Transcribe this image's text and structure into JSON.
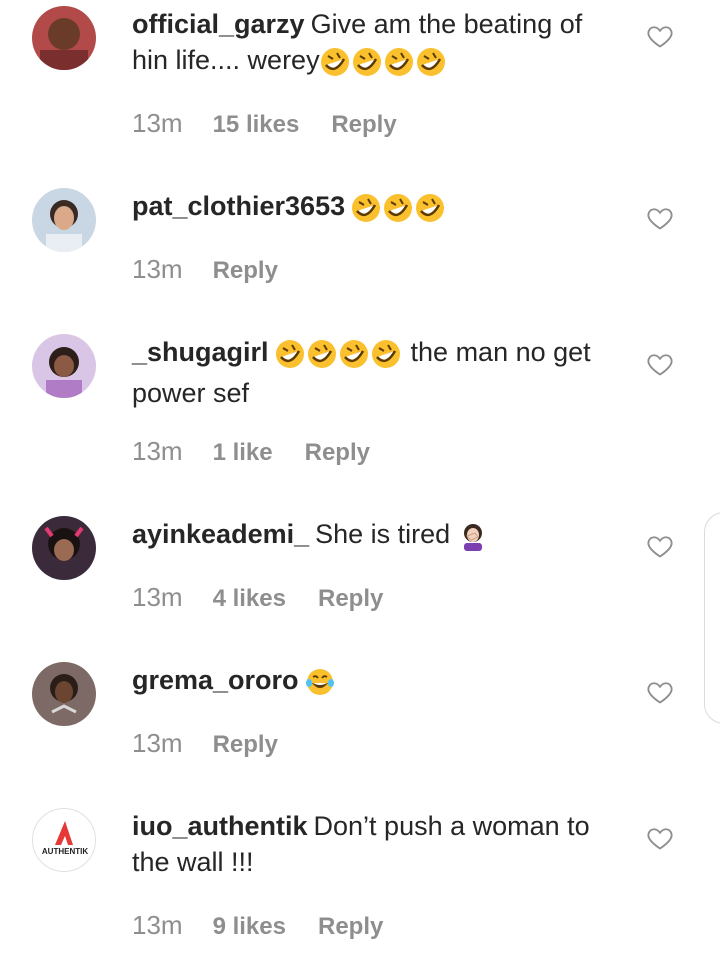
{
  "comments": [
    {
      "username": "official_garzy",
      "text": "Give am the beating of hin life.... werey",
      "emojis": [
        "rofl-emoji",
        "rofl-emoji",
        "rofl-emoji",
        "rofl-emoji"
      ],
      "time": "13m",
      "likes": "15 likes",
      "reply": "Reply"
    },
    {
      "username": "pat_clothier3653",
      "text": "",
      "emojis": [
        "rofl-emoji",
        "rofl-emoji",
        "rofl-emoji"
      ],
      "time": "13m",
      "likes": "",
      "reply": "Reply"
    },
    {
      "username": "_shugagirl",
      "text": "the man no get power sef",
      "emojis": [
        "rofl-emoji",
        "rofl-emoji",
        "rofl-emoji",
        "rofl-emoji"
      ],
      "time": "13m",
      "likes": "1 like",
      "reply": "Reply"
    },
    {
      "username": "ayinkeademi_",
      "text": "She is tired",
      "emojis": [
        "facepalm-emoji"
      ],
      "time": "13m",
      "likes": "4 likes",
      "reply": "Reply"
    },
    {
      "username": "grema_ororo",
      "text": "",
      "emojis": [
        "tears-of-joy-emoji"
      ],
      "time": "13m",
      "likes": "",
      "reply": "Reply"
    },
    {
      "username": "iuo_authentik",
      "text": "Don’t push a woman to the wall !!!",
      "emojis": [],
      "time": "13m",
      "likes": "9 likes",
      "reply": "Reply",
      "avatar_logo_text": "AUTHENTIK"
    }
  ],
  "colors": {
    "text": "#262626",
    "meta": "#8e8e8e",
    "emoji_yellow": "#fbc02d",
    "logo_red": "#e53935"
  }
}
